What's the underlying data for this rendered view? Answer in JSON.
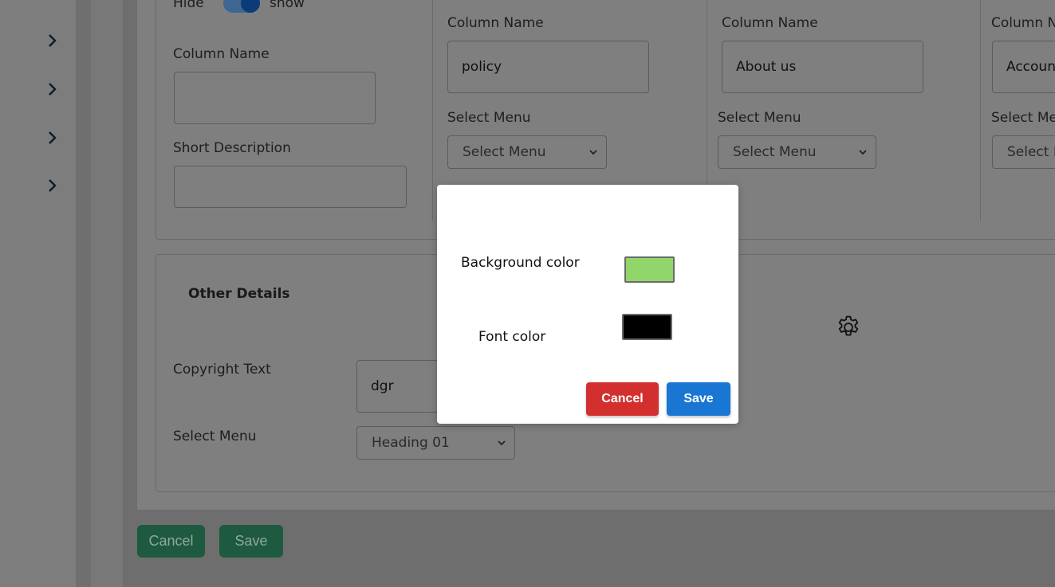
{
  "sidebar": {
    "icons": [
      "chevron-right-icon",
      "chevron-right-icon",
      "chevron-right-icon",
      "chevron-right-icon"
    ]
  },
  "column1": {
    "hide_label": "Hide",
    "show_label": "show",
    "column_name_label": "Column Name",
    "column_name_value": "",
    "short_description_label": "Short Description",
    "short_description_value": ""
  },
  "column2": {
    "column_name_label": "Column Name",
    "column_name_value": "policy",
    "select_menu_label": "Select Menu",
    "select_menu_value": "Select Menu"
  },
  "column3": {
    "column_name_label": "Column Name",
    "column_name_value": "About us",
    "select_menu_label": "Select Menu",
    "select_menu_value": "Select Menu"
  },
  "column4": {
    "column_name_label": "Column N",
    "column_name_value": "Account",
    "select_menu_label": "Select Me",
    "select_menu_value": "Select I"
  },
  "other_details": {
    "title": "Other Details",
    "copyright_label": "Copyright Text",
    "copyright_value": "dgr",
    "select_menu_label": "Select Menu",
    "select_menu_value": "Heading 01"
  },
  "footer": {
    "cancel_label": "Cancel",
    "save_label": "Save"
  },
  "modal": {
    "background_color_label": "Background color",
    "background_color_value": "#90d66a",
    "font_color_label": "Font color",
    "font_color_value": "#000000",
    "cancel_label": "Cancel",
    "save_label": "Save"
  },
  "colors": {
    "cancel_button": "#d32f2f",
    "save_button": "#1976d2",
    "footer_button": "#1d5a3f",
    "overlay": "rgba(0,0,0,0.5)"
  }
}
